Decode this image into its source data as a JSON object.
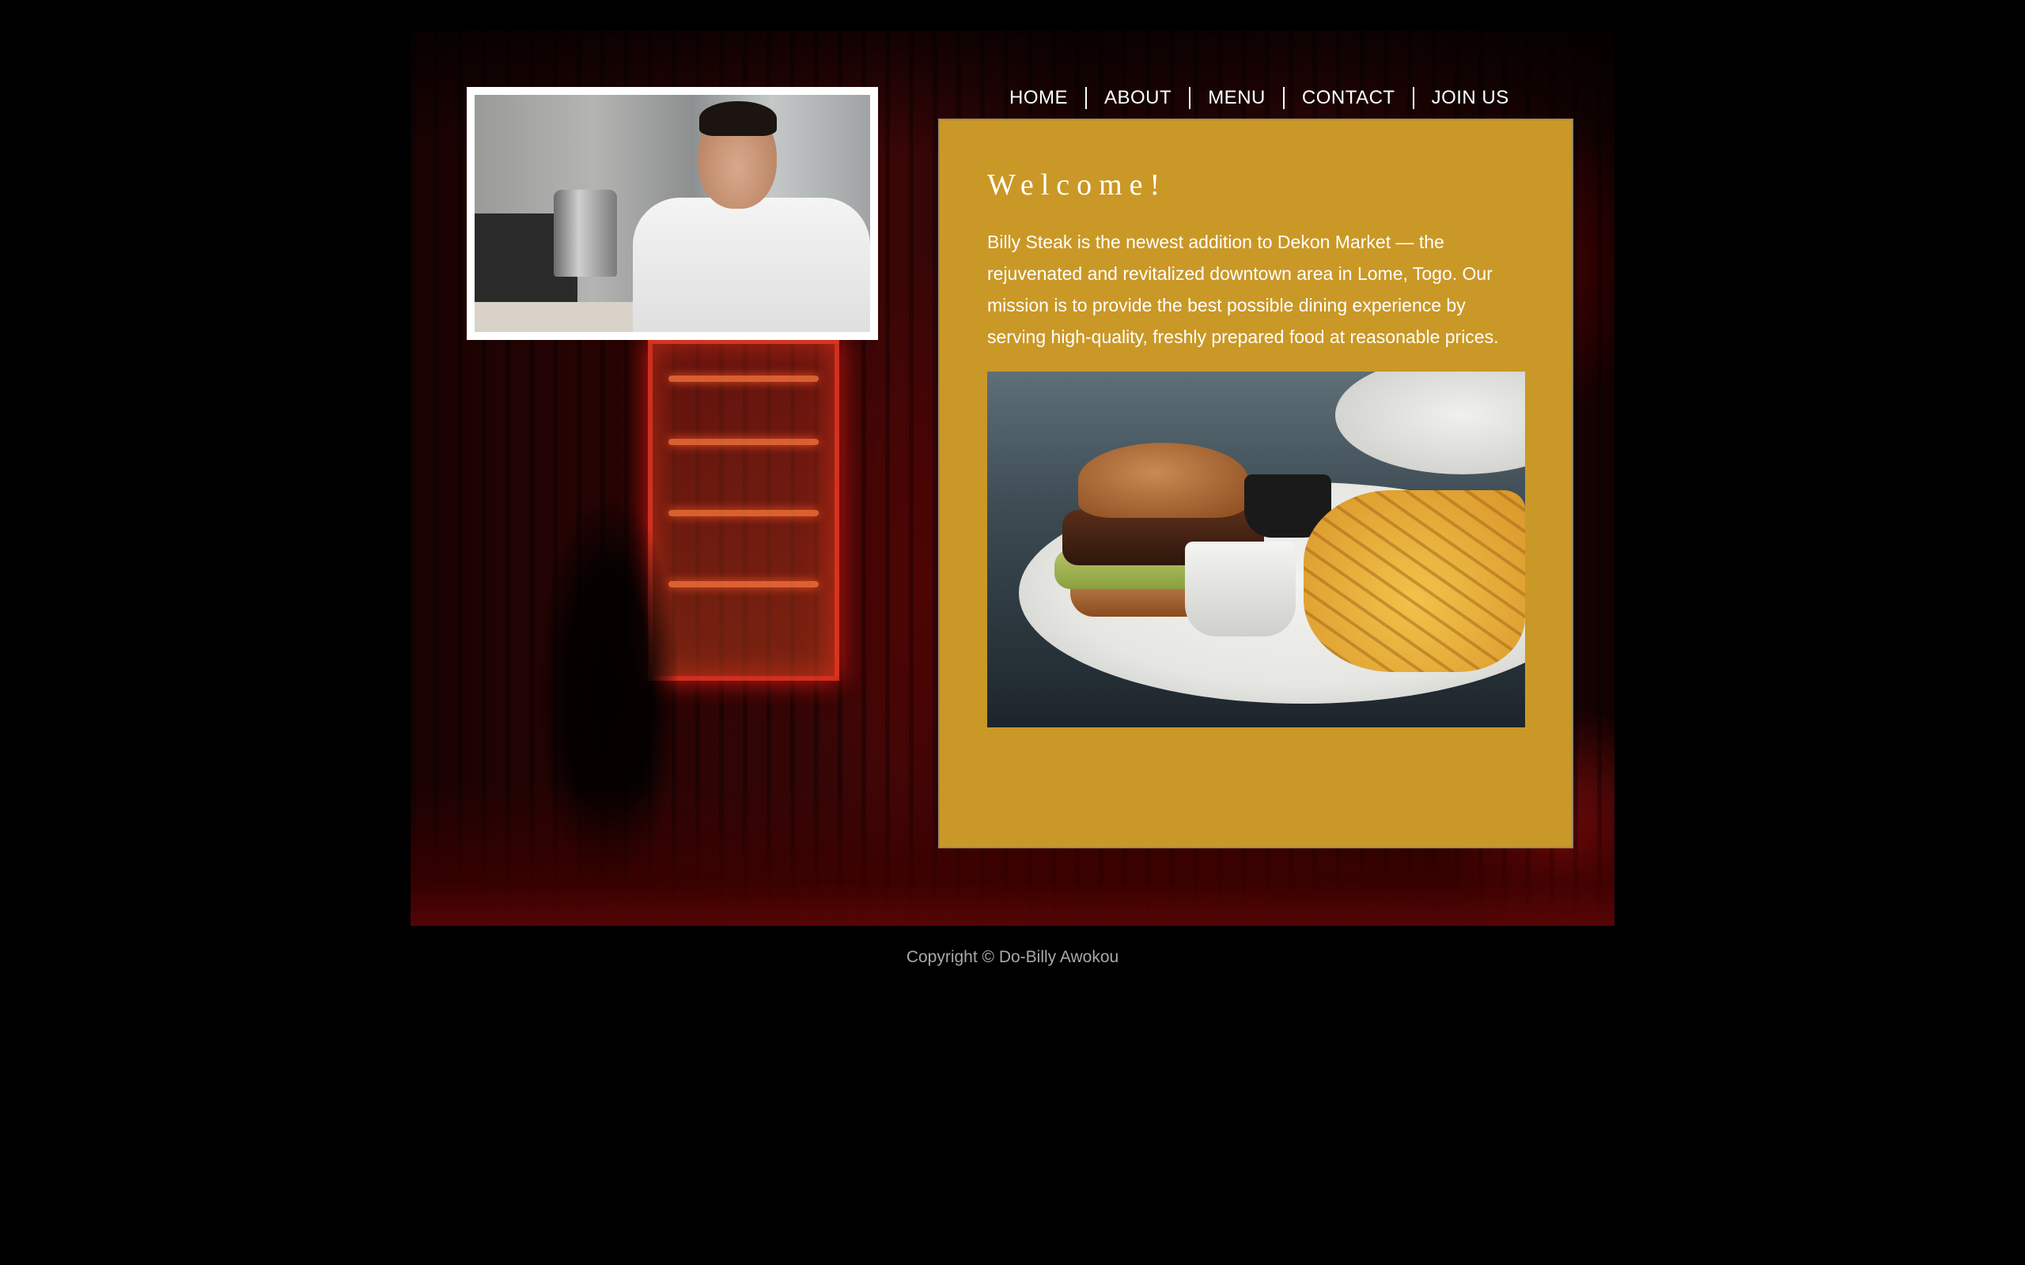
{
  "nav": {
    "items": [
      {
        "label": "HOME"
      },
      {
        "label": "ABOUT"
      },
      {
        "label": "MENU"
      },
      {
        "label": "CONTACT"
      },
      {
        "label": "JOIN US"
      }
    ]
  },
  "main": {
    "heading": "Welcome!",
    "intro": "Billy Steak is the newest addition to Dekon Market — the rejuvenated and revitalized downtown area in Lome, Togo. Our mission is to provide the best possible dining experience by serving high-quality, freshly prepared food at reasonable prices."
  },
  "footer": {
    "copyright": "Copyright © Do-Billy Awokou"
  },
  "colors": {
    "background": "#000000",
    "panel": "#ca9826",
    "nav_text": "#ffffff",
    "footer_text": "#a8a8a8"
  }
}
